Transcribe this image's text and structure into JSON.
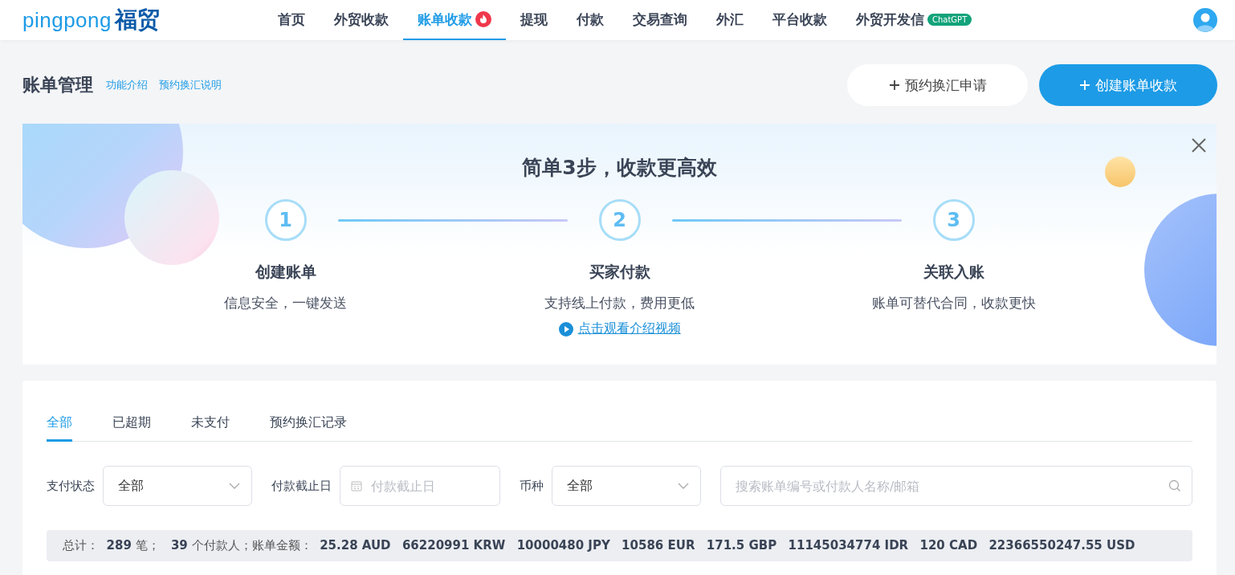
{
  "header": {
    "logo_text": "pingpong",
    "logo_brand": "福贸",
    "nav": [
      {
        "label": "首页",
        "selected": false,
        "hot": false
      },
      {
        "label": "外贸收款",
        "selected": false,
        "hot": false
      },
      {
        "label": "账单收款",
        "selected": true,
        "hot": true
      },
      {
        "label": "提现",
        "selected": false,
        "hot": false
      },
      {
        "label": "付款",
        "selected": false,
        "hot": false
      },
      {
        "label": "交易查询",
        "selected": false,
        "hot": false
      },
      {
        "label": "外汇",
        "selected": false,
        "hot": false
      },
      {
        "label": "平台收款",
        "selected": false,
        "hot": false
      },
      {
        "label": "外贸开发信",
        "selected": false,
        "hot": false,
        "badge": "ChatGPT"
      }
    ]
  },
  "page": {
    "title": "账单管理",
    "links": [
      "功能介绍",
      "预约换汇说明"
    ],
    "buttons": [
      {
        "label": "预约换汇申请",
        "kind": "secondary"
      },
      {
        "label": "创建账单收款",
        "kind": "primary"
      }
    ]
  },
  "banner": {
    "title": "简单3步，收款更高效",
    "steps": [
      {
        "number": "1",
        "title": "创建账单",
        "desc": "信息安全，一键发送"
      },
      {
        "number": "2",
        "title": "买家付款",
        "desc": "支持线上付款，费用更低"
      },
      {
        "number": "3",
        "title": "关联入账",
        "desc": "账单可替代合同，收款更快"
      }
    ],
    "video_link": "点击观看介绍视频"
  },
  "tabs": [
    {
      "label": "全部",
      "selected": true
    },
    {
      "label": "已超期",
      "selected": false
    },
    {
      "label": "未支付",
      "selected": false
    },
    {
      "label": "预约换汇记录",
      "selected": false
    }
  ],
  "filters": [
    {
      "kind": "select",
      "label": "支付状态",
      "value": "全部"
    },
    {
      "kind": "date",
      "label": "付款截止日",
      "placeholder": "付款截止日"
    },
    {
      "kind": "select",
      "label": "币种",
      "value": "全部"
    },
    {
      "kind": "search",
      "placeholder": "搜索账单编号或付款人名称/邮箱"
    }
  ],
  "summary": "总计：  **289** 笔；   **39** 个付款人；账单金额：  **25.28 AUD**   **66220991 KRW**   **10000480 JPY**   **10586 EUR**   **171.5 GBP**   **11145034774 IDR**   **120 CAD**   **22366550247.55 USD**"
}
